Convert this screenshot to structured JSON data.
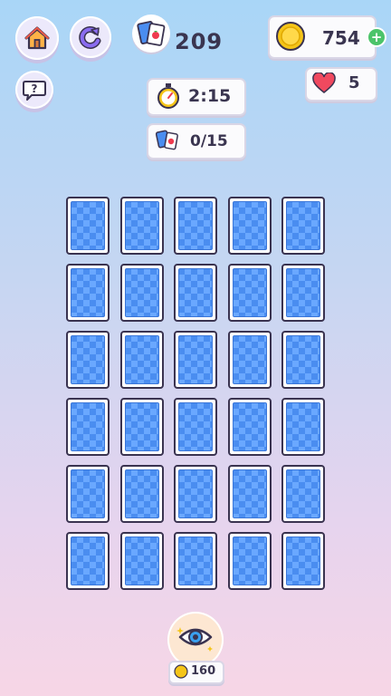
{
  "hud": {
    "score": "209",
    "coins": "754",
    "lives": "5",
    "timer": "2:15",
    "pairs": "0/15",
    "hint_cost": "160"
  },
  "buttons": {
    "home_icon": "home-icon",
    "restart_icon": "restart-icon",
    "help_label": "?",
    "add_coins_label": "+"
  },
  "colors": {
    "card_back": "#4a8df0",
    "card_pattern": "#6aa8ff",
    "card_border": "#3a3350",
    "coin": "#f5c518",
    "heart": "#f0495f",
    "add_button": "#4cc46a"
  },
  "board": {
    "rows": 6,
    "columns": 5,
    "cards_face_down": 30
  }
}
